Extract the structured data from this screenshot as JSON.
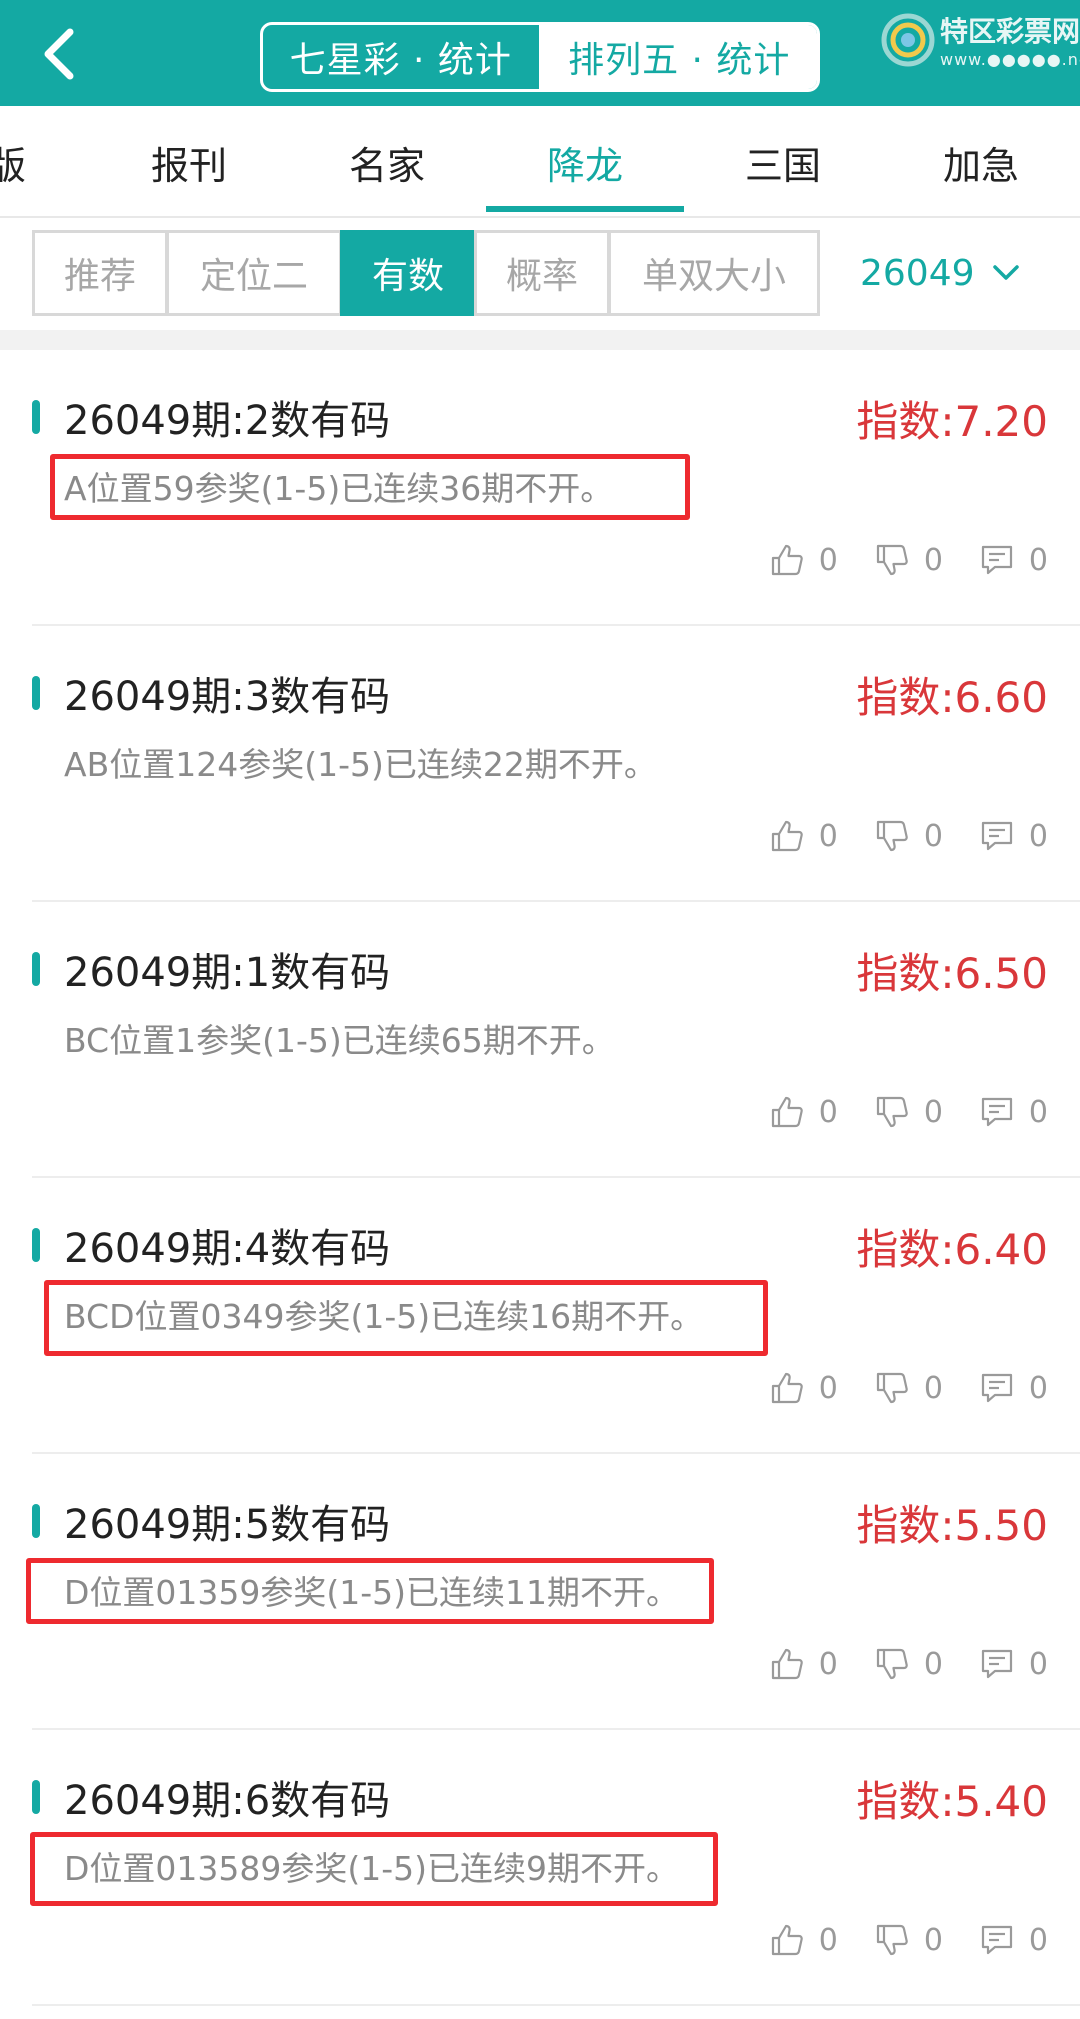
{
  "header": {
    "segments": [
      {
        "label": "七星彩 · 统计",
        "active": false
      },
      {
        "label": "排列五 · 统计",
        "active": true
      }
    ],
    "logo": {
      "name": "特区彩票网",
      "sub": "www.●●●●●.net"
    }
  },
  "category_tabs": [
    {
      "label": "版",
      "active": false
    },
    {
      "label": "报刊",
      "active": false
    },
    {
      "label": "名家",
      "active": false
    },
    {
      "label": "降龙",
      "active": true
    },
    {
      "label": "三国",
      "active": false
    },
    {
      "label": "加急",
      "active": false
    }
  ],
  "filters": [
    {
      "label": "推荐",
      "active": false
    },
    {
      "label": "定位二",
      "active": false
    },
    {
      "label": "有数",
      "active": true
    },
    {
      "label": "概率",
      "active": false
    },
    {
      "label": "单双大小",
      "active": false
    }
  ],
  "issue_select": "26049",
  "colors": {
    "accent": "#14a9a3",
    "index_red": "#d9373a",
    "highlight_box": "#ee2a2f"
  },
  "cards": [
    {
      "title": "26049期:2数有码",
      "index": "指数:7.20",
      "desc": "A位置59参奖(1-5)已连续36期不开。",
      "likes": "0",
      "dislikes": "0",
      "comments": "0",
      "highlighted": true
    },
    {
      "title": "26049期:3数有码",
      "index": "指数:6.60",
      "desc": "AB位置124参奖(1-5)已连续22期不开。",
      "likes": "0",
      "dislikes": "0",
      "comments": "0",
      "highlighted": false
    },
    {
      "title": "26049期:1数有码",
      "index": "指数:6.50",
      "desc": "BC位置1参奖(1-5)已连续65期不开。",
      "likes": "0",
      "dislikes": "0",
      "comments": "0",
      "highlighted": false
    },
    {
      "title": "26049期:4数有码",
      "index": "指数:6.40",
      "desc": "BCD位置0349参奖(1-5)已连续16期不开。",
      "likes": "0",
      "dislikes": "0",
      "comments": "0",
      "highlighted": true
    },
    {
      "title": "26049期:5数有码",
      "index": "指数:5.50",
      "desc": "D位置01359参奖(1-5)已连续11期不开。",
      "likes": "0",
      "dislikes": "0",
      "comments": "0",
      "highlighted": true
    },
    {
      "title": "26049期:6数有码",
      "index": "指数:5.40",
      "desc": "D位置013589参奖(1-5)已连续9期不开。",
      "likes": "0",
      "dislikes": "0",
      "comments": "0",
      "highlighted": true
    }
  ]
}
